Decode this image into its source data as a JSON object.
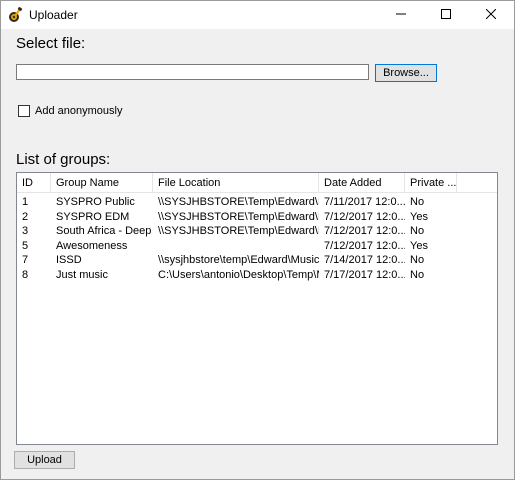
{
  "window": {
    "title": "Uploader",
    "app_icon": "guitar-icon",
    "controls": {
      "minimize": "minimize-icon",
      "maximize": "maximize-icon",
      "close": "close-icon"
    }
  },
  "file_section": {
    "label": "Select file:",
    "input_value": "",
    "browse_label": "Browse..."
  },
  "anonymous": {
    "label": "Add anonymously",
    "checked": false
  },
  "groups": {
    "label": "List of groups:",
    "columns": [
      "ID",
      "Group Name",
      "File Location",
      "Date Added",
      "Private ..."
    ],
    "rows": [
      [
        "1",
        "SYSPRO Public",
        "\\\\SYSJHBSTORE\\Temp\\Edward\\M...",
        "7/11/2017 12:0...",
        "No"
      ],
      [
        "2",
        "SYSPRO EDM",
        "\\\\SYSJHBSTORE\\Temp\\Edward\\M...",
        "7/12/2017 12:0...",
        "Yes"
      ],
      [
        "3",
        "South Africa - Deep ...",
        "\\\\SYSJHBSTORE\\Temp\\Edward\\D...",
        "7/12/2017 12:0...",
        "No"
      ],
      [
        "5",
        "Awesomeness",
        "",
        "7/12/2017 12:0...",
        "Yes"
      ],
      [
        "7",
        "ISSD",
        "\\\\sysjhbstore\\temp\\Edward\\Music",
        "7/14/2017 12:0...",
        "No"
      ],
      [
        "8",
        "Just music",
        "C:\\Users\\antonio\\Desktop\\Temp\\M...",
        "7/17/2017 12:0...",
        "No"
      ]
    ]
  },
  "upload_label": "Upload"
}
